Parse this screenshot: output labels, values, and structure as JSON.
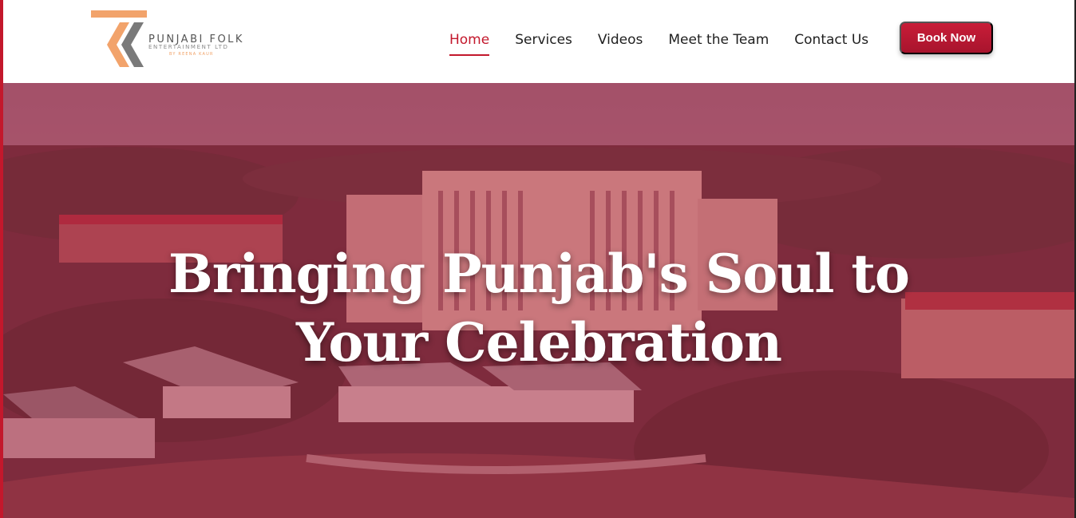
{
  "brand": {
    "name": "PUNJABI FOLK",
    "subtitle": "ENTERTAINMENT LTD",
    "byline": "BY REENA KAUR",
    "colors": {
      "accent": "#c3182c",
      "logo_orange": "#f2a36b",
      "logo_gray": "#7a7a7a"
    }
  },
  "nav": {
    "items": [
      {
        "label": "Home",
        "active": true
      },
      {
        "label": "Services",
        "active": false
      },
      {
        "label": "Videos",
        "active": false
      },
      {
        "label": "Meet the Team",
        "active": false
      },
      {
        "label": "Contact Us",
        "active": false
      }
    ],
    "cta_label": "Book Now"
  },
  "hero": {
    "title_line1": "Bringing Punjab's Soul to",
    "title_line2": "Your Celebration",
    "background": "aerial-resort-photo"
  }
}
